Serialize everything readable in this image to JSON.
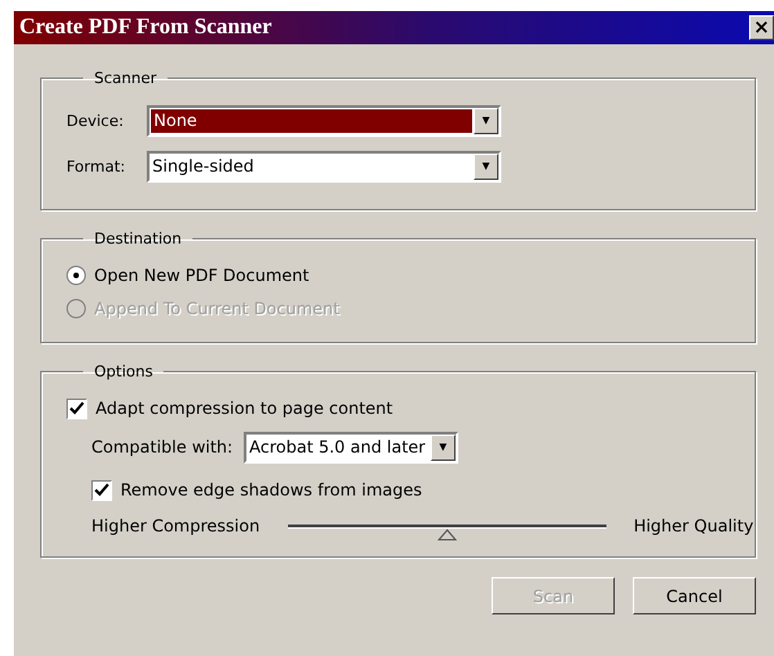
{
  "window": {
    "title": "Create PDF From Scanner",
    "close": "×"
  },
  "scanner": {
    "legend": "Scanner",
    "fields": [
      {
        "label": "Device:",
        "value": "None",
        "highlighted": true,
        "arrow": "▼"
      },
      {
        "label": "Format:",
        "value": "Single-sided",
        "highlighted": false,
        "arrow": "▼"
      }
    ]
  },
  "destination": {
    "legend": "Destination",
    "options": [
      {
        "label": "Open New PDF Document",
        "selected": true,
        "disabled": false
      },
      {
        "label": "Append To Current Document",
        "selected": false,
        "disabled": true
      }
    ]
  },
  "options": {
    "legend": "Options",
    "adapt": {
      "label": "Adapt compression to page content",
      "checked": true
    },
    "compatible": {
      "label": "Compatible with:",
      "value": "Acrobat 5.0 and later",
      "arrow": "▼"
    },
    "shadows": {
      "label": "Remove edge shadows from images",
      "checked": true
    },
    "slider": {
      "left": "Higher Compression",
      "right": "Higher Quality",
      "level": 0.5
    }
  },
  "buttons": [
    {
      "label": "Scan",
      "disabled": true
    },
    {
      "label": "Cancel",
      "disabled": false
    }
  ]
}
